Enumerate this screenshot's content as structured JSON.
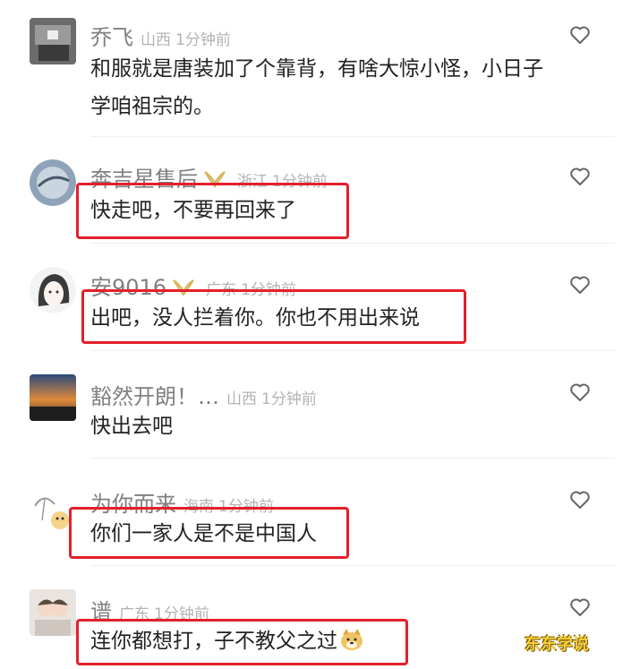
{
  "comments": [
    {
      "user": "乔飞",
      "location": "山西",
      "time": "1分钟前",
      "lines": [
        "和服就是唐装加了个靠背，有啥大惊小怪，小日子",
        "学咱祖宗的。"
      ],
      "vip": false
    },
    {
      "user": "奔吉星售后",
      "location": "浙江",
      "time": "1分钟前",
      "lines": [
        "快走吧，不要再回来了"
      ],
      "vip": true
    },
    {
      "user": "安9016",
      "location": "广东",
      "time": "1分钟前",
      "lines": [
        "出吧，没人拦着你。你也不用出来说"
      ],
      "vip": true
    },
    {
      "user": "豁然开朗！…",
      "location": "山西",
      "time": "1分钟前",
      "lines": [
        "快出去吧"
      ],
      "vip": false
    },
    {
      "user": "为你而来",
      "location": "海南",
      "time": "1分钟前",
      "lines": [
        "你们一家人是不是中国人"
      ],
      "vip": false
    },
    {
      "user": "谱",
      "location": "广东",
      "time": "1分钟前",
      "lines": [
        "连你都想打，子不教父之过"
      ],
      "vip": false
    }
  ],
  "watermark": "东东学说",
  "colors": {
    "highlight": "#e3202b",
    "vip_badge": "#d8b35a",
    "muted": "#808080"
  },
  "icons": {
    "like": "heart-outline-icon",
    "vip": "vip-badge-icon",
    "emoji": "doge-emoji-icon"
  }
}
